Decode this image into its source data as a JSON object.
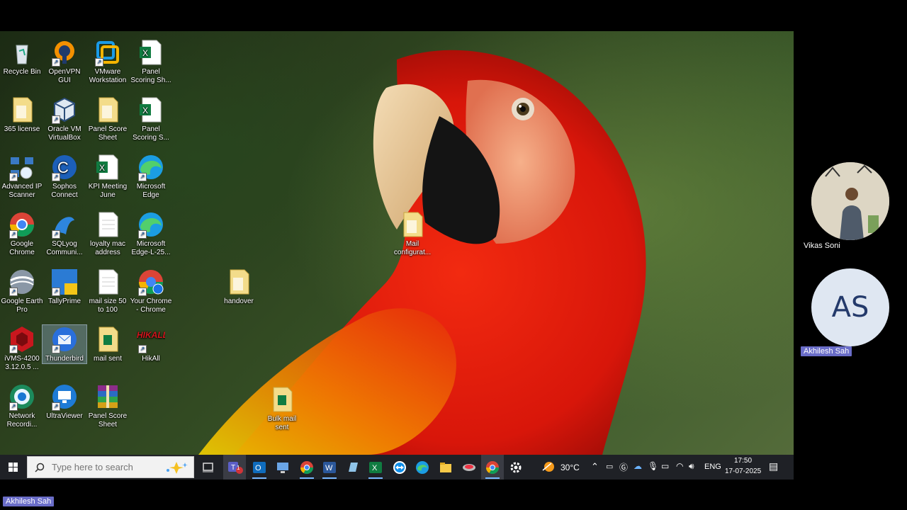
{
  "desktop": {
    "icons": [
      {
        "label": "Recycle Bin",
        "icon": "recycle-bin-icon"
      },
      {
        "label": "OpenVPN GUI",
        "icon": "openvpn-icon"
      },
      {
        "label": "VMware Workstation",
        "icon": "vmware-icon"
      },
      {
        "label": "Panel Scoring Sh...",
        "icon": "excel-file-icon"
      },
      {
        "label": "365 license",
        "icon": "folder-icon"
      },
      {
        "label": "Oracle VM VirtualBox",
        "icon": "virtualbox-icon"
      },
      {
        "label": "Panel Score Sheet",
        "icon": "folder-icon"
      },
      {
        "label": "Panel Scoring S...",
        "icon": "excel-file-icon"
      },
      {
        "label": "Advanced IP Scanner",
        "icon": "ip-scanner-icon"
      },
      {
        "label": "Sophos Connect",
        "icon": "sophos-icon"
      },
      {
        "label": "KPI Meeting June",
        "icon": "excel-file-icon"
      },
      {
        "label": "Microsoft Edge",
        "icon": "edge-icon"
      },
      {
        "label": "Google Chrome",
        "icon": "chrome-icon"
      },
      {
        "label": "SQLyog Communi...",
        "icon": "sqlyog-icon"
      },
      {
        "label": "loyalty mac address",
        "icon": "text-file-icon"
      },
      {
        "label": "Microsoft Edge-L-25...",
        "icon": "edge-icon"
      },
      {
        "label": "Google Earth Pro",
        "icon": "google-earth-icon"
      },
      {
        "label": "TallyPrime",
        "icon": "tally-icon"
      },
      {
        "label": "mail size 50 to 100",
        "icon": "text-file-icon"
      },
      {
        "label": "Your Chrome - Chrome",
        "icon": "chrome-profile-icon"
      },
      {
        "label": "handover",
        "icon": "folder-icon"
      },
      {
        "label": "iVMS-4200 3.12.0.5 ...",
        "icon": "ivms-icon"
      },
      {
        "label": "Thunderbird",
        "icon": "thunderbird-icon"
      },
      {
        "label": "mail sent",
        "icon": "folder-excel-icon"
      },
      {
        "label": "HikAll",
        "icon": "hikall-icon"
      },
      {
        "label": "Network Recordi...",
        "icon": "network-recorder-icon"
      },
      {
        "label": "UltraViewer",
        "icon": "ultraviewer-icon"
      },
      {
        "label": "Panel Score Sheet",
        "icon": "winrar-icon"
      },
      {
        "label": "Mail configurat...",
        "icon": "folder-icon"
      },
      {
        "label": "Bulk mail sent",
        "icon": "folder-excel-icon"
      }
    ],
    "wallpaper": "parrot"
  },
  "taskbar": {
    "search_placeholder": "Type here to search",
    "apps": [
      "task-view-icon",
      "teams-icon",
      "outlook-icon",
      "remote-desktop-icon",
      "chrome-icon",
      "word-icon",
      "notepad-icon",
      "excel-icon",
      "teamviewer-icon",
      "edge-icon",
      "file-explorer-icon",
      "network-icon",
      "chrome-icon",
      "settings-icon"
    ],
    "teams_badge": "1",
    "weather": "30°C",
    "language": "ENG",
    "time": "17:50",
    "date": "17-07-2025"
  },
  "meeting": {
    "participant1_name": "Vikas Soni",
    "participant2_initials": "AS",
    "participant2_name": "Akhilesh Sah",
    "presenter_name": "Akhilesh Sah"
  },
  "colors": {
    "accent": "#6a6dc8",
    "taskbar": "#1f2126",
    "avatar_bg": "#dfe7f2",
    "avatar_text": "#243a6b"
  }
}
